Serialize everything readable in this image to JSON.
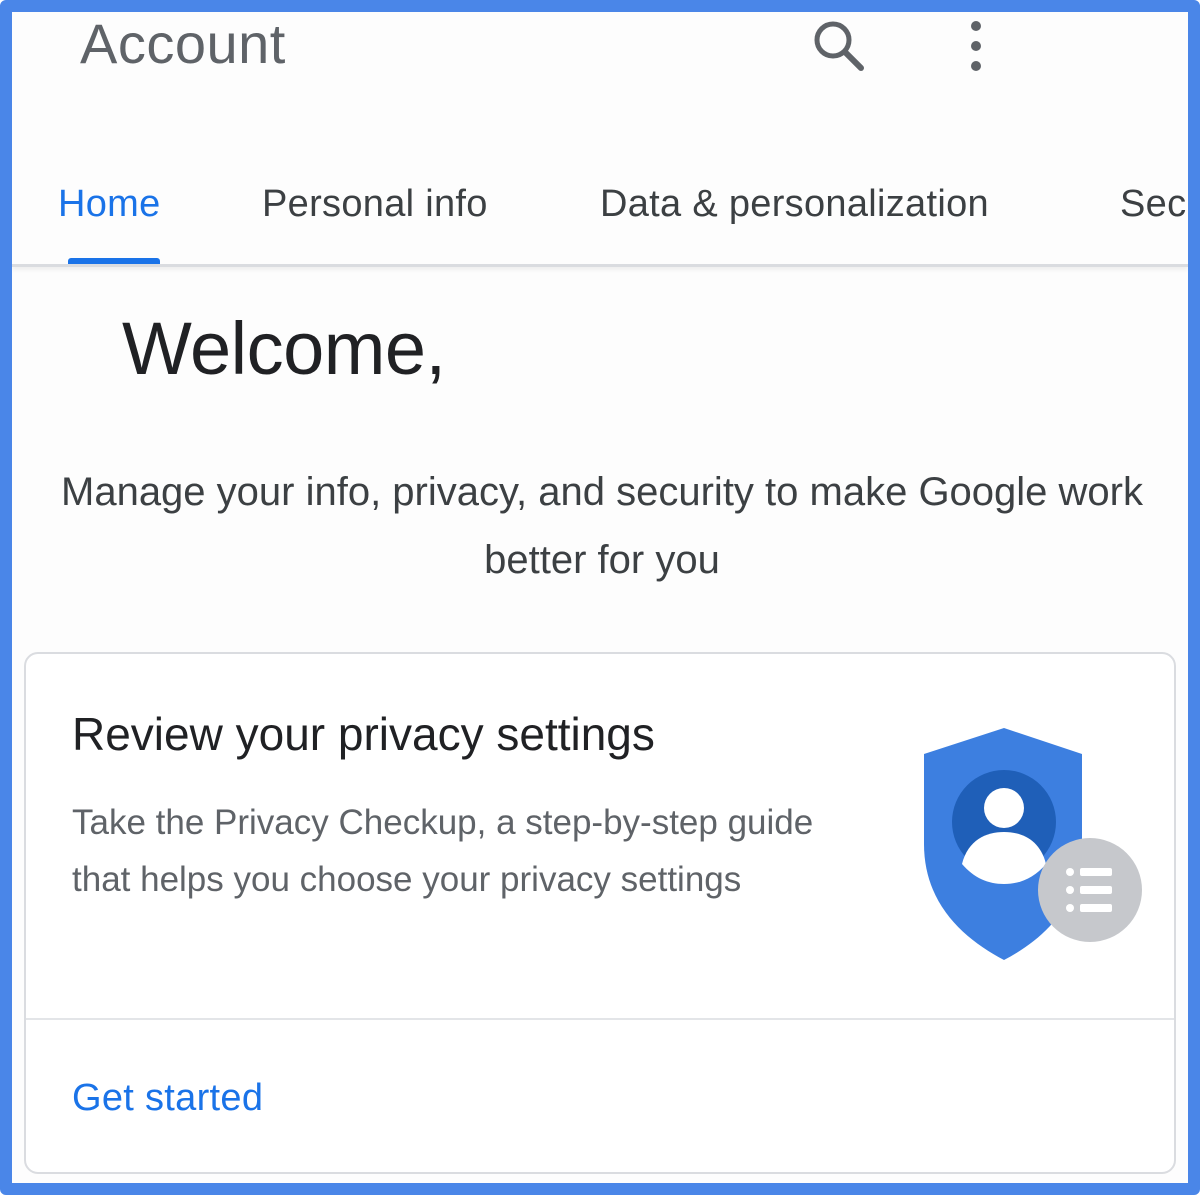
{
  "app_bar": {
    "title": "Account",
    "search_icon": "search-icon",
    "menu_icon": "more-vert-icon"
  },
  "tabs": [
    {
      "label": "Home",
      "active": true
    },
    {
      "label": "Personal info",
      "active": false
    },
    {
      "label": "Data & personalization",
      "active": false
    },
    {
      "label": "Sec",
      "active": false
    }
  ],
  "main": {
    "greeting": "Welcome,",
    "subtitle": "Manage your info, privacy, and security to make Google work better for you"
  },
  "privacy_card": {
    "title": "Review your privacy settings",
    "description": "Take the Privacy Checkup, a step-by-step guide that helps you choose your privacy settings",
    "illustration_icon": "privacy-shield-icon",
    "action_label": "Get started"
  },
  "colors": {
    "frame_border": "#4a86e8",
    "accent": "#1a73e8",
    "shield_blue": "#3d7fe0",
    "person_dark_blue": "#1f5fb8",
    "badge_gray": "#c6c8cc"
  }
}
